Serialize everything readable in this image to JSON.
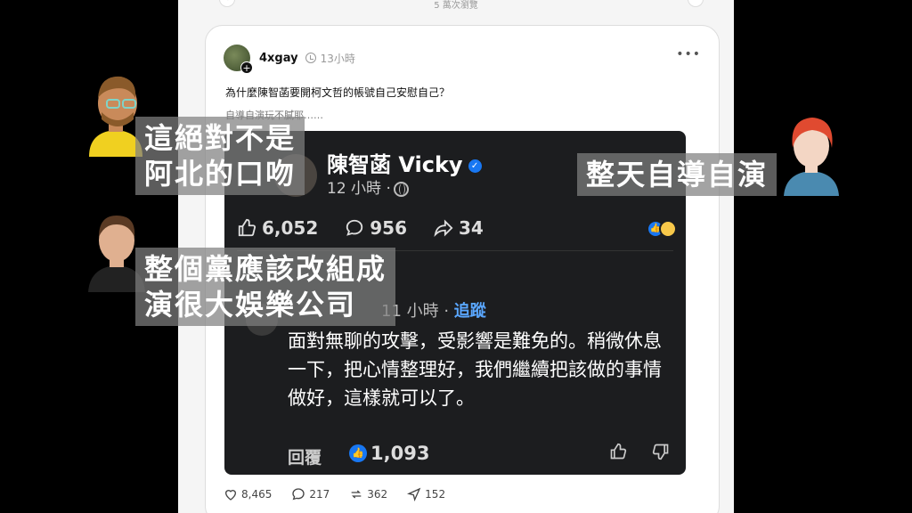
{
  "feed": {
    "view_count": "5 萬次瀏覽"
  },
  "post": {
    "username": "4xgay",
    "time": "13小時",
    "caption": "為什麼陳智菡要開柯文哲的帳號自己安慰自己？",
    "caption_second": "自導自演玩不膩耶……",
    "more_label": "•••",
    "footer": {
      "likes": "8,465",
      "comments": "217",
      "reposts": "362",
      "shares": "152"
    }
  },
  "embedded": {
    "name": "陳智菡 Vicky",
    "time": "12 小時 ·",
    "likes": "6,052",
    "comments": "956",
    "shares": "34",
    "comment": {
      "meta": "11 小時 · ",
      "follow": "追蹤",
      "text": "面對無聊的攻擊，受影響是難免的。稍微休息一下，把心情整理好，我們繼續把該做的事情做好，這樣就可以了。",
      "reply": "回覆",
      "likes": "1,093"
    }
  },
  "overlays": {
    "top_left_line1": "這絕對不是",
    "top_left_line2": "阿北的口吻",
    "top_right": "整天自導自演",
    "bottom_left_line1": "整個黨應該改組成",
    "bottom_left_line2": "演很大娛樂公司"
  },
  "colors": {
    "accent": "#1877f2",
    "follow": "#5aa7ff"
  }
}
